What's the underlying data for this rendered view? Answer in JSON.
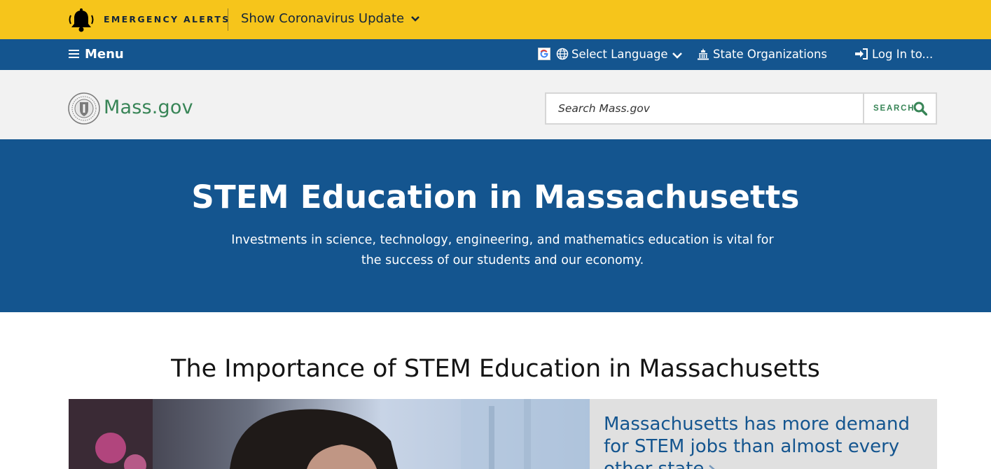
{
  "alert_bar": {
    "label": "EMERGENCY ALERTS",
    "toggle": "Show Coronavirus Update",
    "bg_color": "#f6c51b"
  },
  "utility_nav": {
    "menu": "Menu",
    "language": "Select Language",
    "state_orgs": "State Organizations",
    "login": "Log In to...",
    "bg_color": "#14558f"
  },
  "header": {
    "logo_text": "Mass.gov",
    "search_placeholder": "Search Mass.gov",
    "search_button": "SEARCH",
    "accent_color": "#388557"
  },
  "hero": {
    "title": "STEM Education in Massachusetts",
    "subtitle": "Investments in science, technology, engineering, and mathematics education is vital for the success of our students and our economy."
  },
  "section": {
    "title": "The Importance of STEM Education in Massachusetts",
    "promo_link": "Massachusetts has more demand for STEM jobs than almost every other state"
  },
  "icons": [
    "bell-icon",
    "chevron-down-icon",
    "hamburger-icon",
    "google-translate-icon",
    "globe-icon",
    "building-icon",
    "login-icon",
    "state-seal-icon",
    "search-icon",
    "arrow-right-icon"
  ]
}
